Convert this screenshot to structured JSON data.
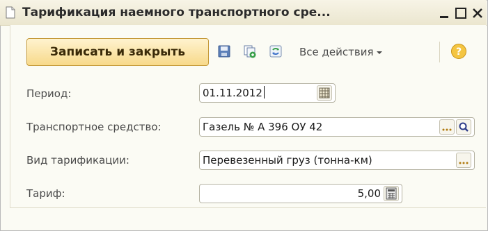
{
  "window": {
    "title": "Тарификация наемного транспортного сре...",
    "icons": [
      "document-icon",
      "minimize-icon",
      "maximize-icon",
      "close-icon"
    ]
  },
  "toolbar": {
    "save_close_label": "Записать и закрыть",
    "all_actions_label": "Все действия",
    "icons": [
      "save-icon",
      "copy-icon",
      "refresh-icon",
      "chevron-down-icon",
      "help-icon"
    ]
  },
  "form": {
    "period": {
      "label": "Период:",
      "value": "01.11.2012"
    },
    "vehicle": {
      "label": "Транспортное средство:",
      "value": "Газель № А 396 ОУ 42"
    },
    "tariff_type": {
      "label": "Вид тарификации:",
      "value": "Перевезенный груз (тонна-км)"
    },
    "tariff": {
      "label": "Тариф:",
      "value": "5,00"
    }
  },
  "colors": {
    "titlebar": "#ebe6cf",
    "primary_button": "#f7d98a",
    "accent_yellow": "#f0c030",
    "icon_blue": "#4a74b8",
    "icon_green": "#3aa04a"
  }
}
